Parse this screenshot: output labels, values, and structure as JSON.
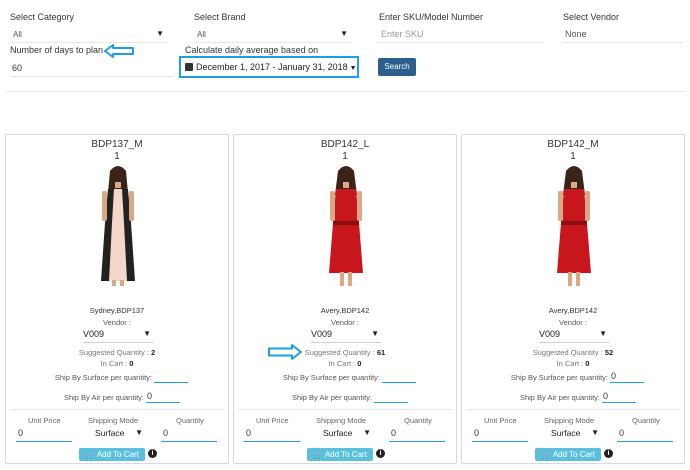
{
  "filters": {
    "category_label": "Select Category",
    "category_value": "All",
    "brand_label": "Select Brand",
    "brand_value": "All",
    "sku_label": "Enter SKU/Model Number",
    "sku_placeholder": "Enter SKU",
    "vendor_label": "Select Vendor",
    "vendor_value": "None",
    "days_label": "Number of days to plan",
    "days_value": "60",
    "average_label": "Calculate daily average based on",
    "date_range": "December 1, 2017 - January 31, 2018",
    "search_label": "Search"
  },
  "annotation_color": "#1e9ee8",
  "card_labels": {
    "vendor": "Vendor :",
    "suggested": "Suggested Quantity :",
    "in_cart": "In Cart :",
    "ship_surface": "Ship By Surface per quantity:",
    "ship_air": "Ship By Air per quantity:",
    "unit_price": "Unit Price",
    "shipping_mode": "Shipping Mode",
    "quantity": "Quantity",
    "add_to_cart": "Add To Cart"
  },
  "products": [
    {
      "sku": "BDP137_M",
      "count": "1",
      "name": "Sydney,BDP137",
      "vendor": "V009",
      "suggested_qty": "2",
      "in_cart": "0",
      "surface_value": "",
      "air_value": "0",
      "unit_price": "0",
      "shipping_mode": "Surface",
      "quantity": "0",
      "dress_color": "#f3d8c9",
      "accent_color": "#222222"
    },
    {
      "sku": "BDP142_L",
      "count": "1",
      "name": "Avery,BDP142",
      "vendor": "V009",
      "suggested_qty": "61",
      "in_cart": "0",
      "surface_value": "",
      "air_value": "",
      "unit_price": "0",
      "shipping_mode": "Surface",
      "quantity": "0",
      "dress_color": "#c8161d",
      "accent_color": "#8a0d12"
    },
    {
      "sku": "BDP142_M",
      "count": "1",
      "name": "Avery,BDP142",
      "vendor": "V009",
      "suggested_qty": "52",
      "in_cart": "0",
      "surface_value": "0",
      "air_value": "0",
      "unit_price": "0",
      "shipping_mode": "Surface",
      "quantity": "0",
      "dress_color": "#c8161d",
      "accent_color": "#8a0d12"
    }
  ]
}
